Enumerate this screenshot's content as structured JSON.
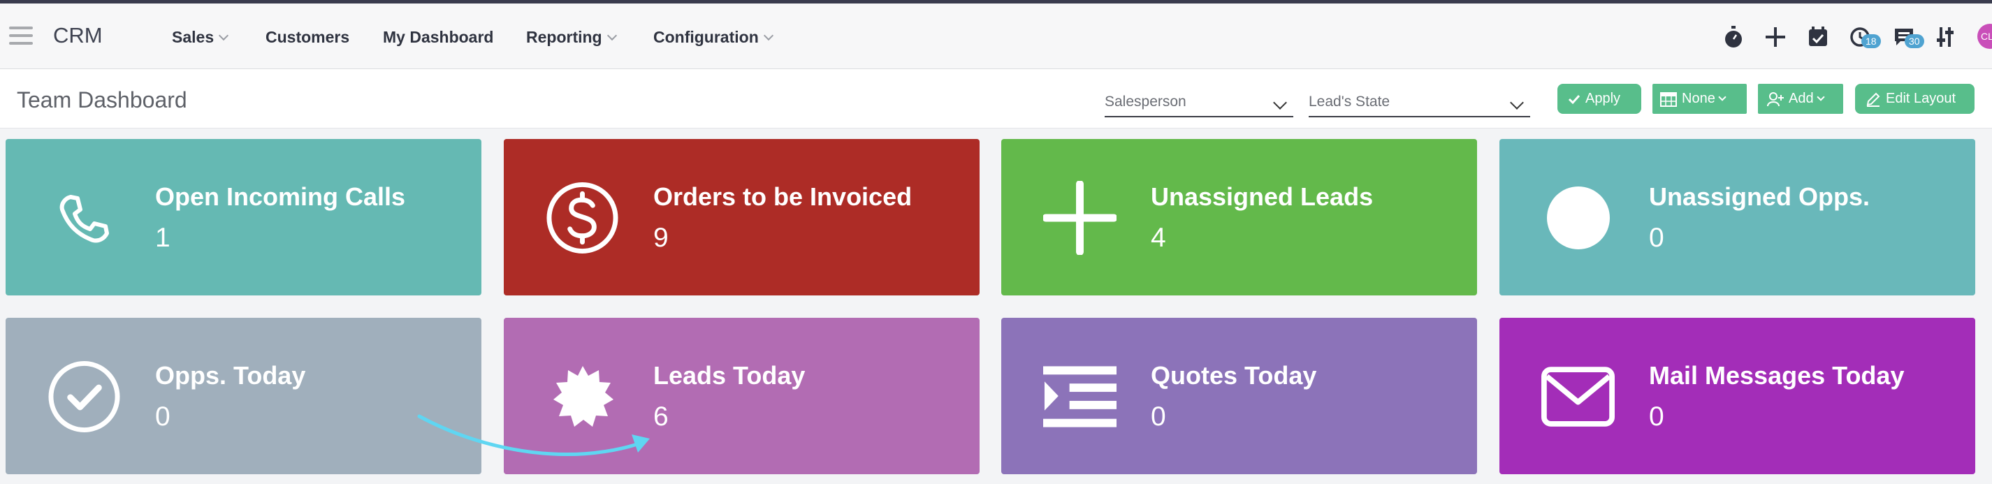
{
  "app": {
    "name": "CRM"
  },
  "nav": {
    "items": [
      {
        "label": "Sales",
        "dropdown": true
      },
      {
        "label": "Customers",
        "dropdown": false
      },
      {
        "label": "My Dashboard",
        "dropdown": false
      },
      {
        "label": "Reporting",
        "dropdown": true
      },
      {
        "label": "Configuration",
        "dropdown": true
      }
    ]
  },
  "systray": {
    "activity_count": "18",
    "messages_count": "30",
    "avatar_initials": "CL"
  },
  "page": {
    "title": "Team Dashboard"
  },
  "filters": {
    "salesperson": "Salesperson",
    "lead_state": "Lead's State"
  },
  "actions": {
    "apply": "Apply",
    "none": "None",
    "add": "Add",
    "edit_layout": "Edit Layout"
  },
  "tiles": [
    {
      "label": "Open Incoming Calls",
      "count": "1",
      "color": "#65b9b3",
      "icon": "phone-icon"
    },
    {
      "label": "Orders to be Invoiced",
      "count": "9",
      "color": "#ad2c26",
      "icon": "dollar-circle-icon"
    },
    {
      "label": "Unassigned Leads",
      "count": "4",
      "color": "#63b94b",
      "icon": "plus-icon"
    },
    {
      "label": "Unassigned Opps.",
      "count": "0",
      "color": "#69b8ba",
      "icon": "circle-icon"
    },
    {
      "label": "Opps. Today",
      "count": "0",
      "color": "#a0afbc",
      "icon": "check-circle-icon"
    },
    {
      "label": "Leads Today",
      "count": "6",
      "color": "#b26cb3",
      "icon": "starburst-icon"
    },
    {
      "label": "Quotes Today",
      "count": "0",
      "color": "#8c73b9",
      "icon": "list-indent-icon"
    },
    {
      "label": "Mail Messages Today",
      "count": "0",
      "color": "#a32db8",
      "icon": "envelope-icon"
    }
  ]
}
